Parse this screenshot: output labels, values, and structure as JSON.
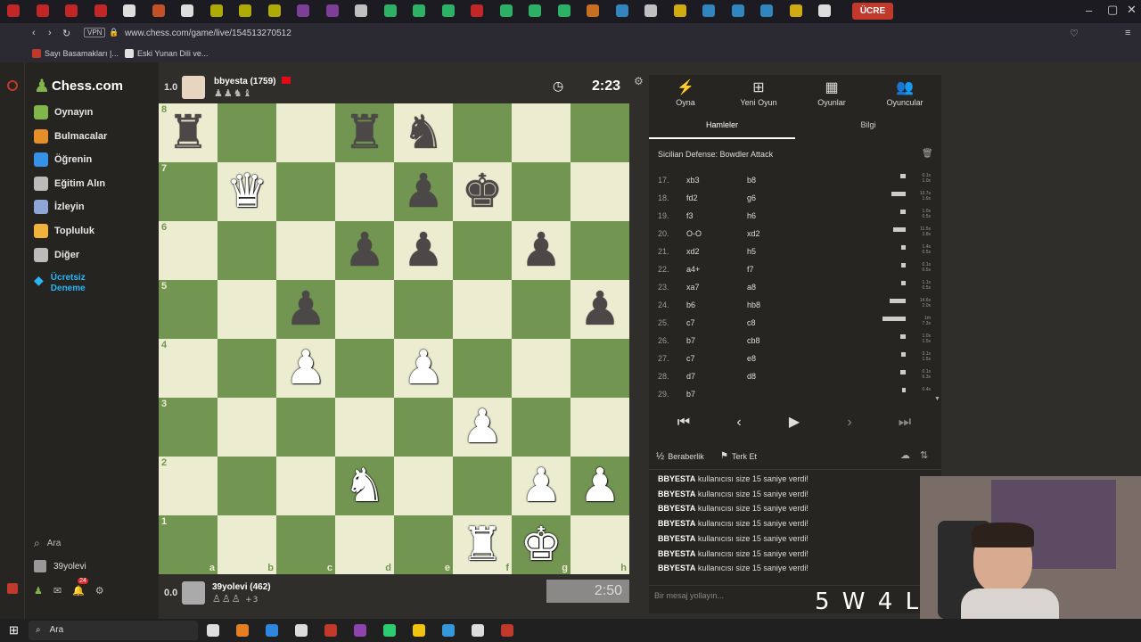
{
  "browser": {
    "url": "www.chess.com/game/live/154513270512",
    "vpn_label": "VPN",
    "tab_badge": "ÜCRE",
    "bookmarks": [
      "Sayı Basamakları |...",
      "Eski Yunan Dili ve..."
    ]
  },
  "sidenav": {
    "logo": "Chess.com",
    "items": [
      {
        "label": "Oynayın",
        "color": "#81b64c"
      },
      {
        "label": "Bulmacalar",
        "color": "#e58f2a"
      },
      {
        "label": "Öğrenin",
        "color": "#3692e7"
      },
      {
        "label": "Eğitim Alın",
        "color": "#bbbbbb"
      },
      {
        "label": "İzleyin",
        "color": "#8fa5d6"
      },
      {
        "label": "Topluluk",
        "color": "#f2b33d"
      },
      {
        "label": "Diğer",
        "color": "#bbbbbb"
      }
    ],
    "premium_line1": "Ücretsiz",
    "premium_line2": "Deneme",
    "search_label": "Ara",
    "user_label": "39yolevi",
    "notification_count": "24"
  },
  "top_player": {
    "score": "1.0",
    "name": "bbyesta (1759)",
    "clock": "2:23"
  },
  "bottom_player": {
    "score": "0.0",
    "name": "39yolevi (462)",
    "captured_extra": "+3",
    "clock": "2:50"
  },
  "board": {
    "rank_labels": [
      "8",
      "7",
      "6",
      "5",
      "4",
      "3",
      "2",
      "1"
    ],
    "file_labels": [
      "a",
      "b",
      "c",
      "d",
      "e",
      "f",
      "g",
      "h"
    ],
    "rows": [
      [
        "bR",
        "",
        "",
        "bR",
        "bN",
        "",
        "",
        ""
      ],
      [
        "",
        "wQ",
        "",
        "",
        "bP",
        "bK",
        "",
        ""
      ],
      [
        "",
        "",
        "",
        "bP",
        "bP",
        "",
        "bP",
        ""
      ],
      [
        "",
        "",
        "bP",
        "",
        "",
        "",
        "",
        "bP"
      ],
      [
        "",
        "",
        "wP",
        "",
        "wP",
        "",
        "",
        ""
      ],
      [
        "",
        "",
        "",
        "",
        "",
        "wP",
        "",
        ""
      ],
      [
        "",
        "",
        "",
        "wN",
        "",
        "",
        "wP",
        "wP"
      ],
      [
        "",
        "",
        "",
        "",
        "",
        "wR",
        "wK",
        ""
      ]
    ]
  },
  "panel": {
    "tabs": [
      {
        "icon": "⚡",
        "label": "Oyna"
      },
      {
        "icon": "⊞",
        "label": "Yeni Oyun"
      },
      {
        "icon": "▦",
        "label": "Oyunlar"
      },
      {
        "icon": "👥",
        "label": "Oyuncular"
      }
    ],
    "subtabs": [
      "Hamleler",
      "Bilgi"
    ],
    "opening": "Sicilian Defense: Bowdler Attack",
    "moves": [
      {
        "n": "17.",
        "w": "xb3",
        "b": "b8",
        "wt": "0.1s",
        "bt": "1.0s",
        "bar": 6
      },
      {
        "n": "18.",
        "w": "fd2",
        "b": "g6",
        "wt": "13.7s",
        "bt": "1.6s",
        "bar": 16
      },
      {
        "n": "19.",
        "w": "f3",
        "b": "h6",
        "wt": "1.0s",
        "bt": "0.5s",
        "bar": 6
      },
      {
        "n": "20.",
        "w": "O-O",
        "b": "xd2",
        "wt": "11.5s",
        "bt": "3.8s",
        "bar": 14
      },
      {
        "n": "21.",
        "w": "xd2",
        "b": "h5",
        "wt": "1.4s",
        "bt": "0.5s",
        "bar": 5
      },
      {
        "n": "22.",
        "w": "a4+",
        "b": "f7",
        "wt": "0.1s",
        "bt": "0.5s",
        "bar": 5
      },
      {
        "n": "23.",
        "w": "xa7",
        "b": "a8",
        "wt": "1.1s",
        "bt": "0.5s",
        "bar": 5
      },
      {
        "n": "24.",
        "w": "b6",
        "b": "hb8",
        "wt": "14.6s",
        "bt": "2.0s",
        "bar": 18
      },
      {
        "n": "25.",
        "w": "c7",
        "b": "c8",
        "wt": "1m",
        "bt": "7.3s",
        "bar": 26
      },
      {
        "n": "26.",
        "w": "b7",
        "b": "cb8",
        "wt": "1.0s",
        "bt": "1.5s",
        "bar": 6
      },
      {
        "n": "27.",
        "w": "c7",
        "b": "e8",
        "wt": "3.1s",
        "bt": "1.5s",
        "bar": 5
      },
      {
        "n": "28.",
        "w": "d7",
        "b": "d8",
        "wt": "0.1s",
        "bt": "6.3s",
        "bar": 6
      },
      {
        "n": "29.",
        "w": "b7",
        "b": "",
        "wt": "0.4s",
        "bt": "",
        "bar": 4
      }
    ],
    "draw_label": "Beraberlik",
    "resign_label": "Terk Et",
    "chat_user": "BBYESTA",
    "chat_text": "kullanıcısı size 15 saniye verdi!",
    "chat_count": 7,
    "chat_placeholder": "Bir mesaj yollayın..."
  },
  "overlay": {
    "stream_text": "5 W 4 L"
  },
  "taskbar": {
    "search_label": "Ara"
  }
}
